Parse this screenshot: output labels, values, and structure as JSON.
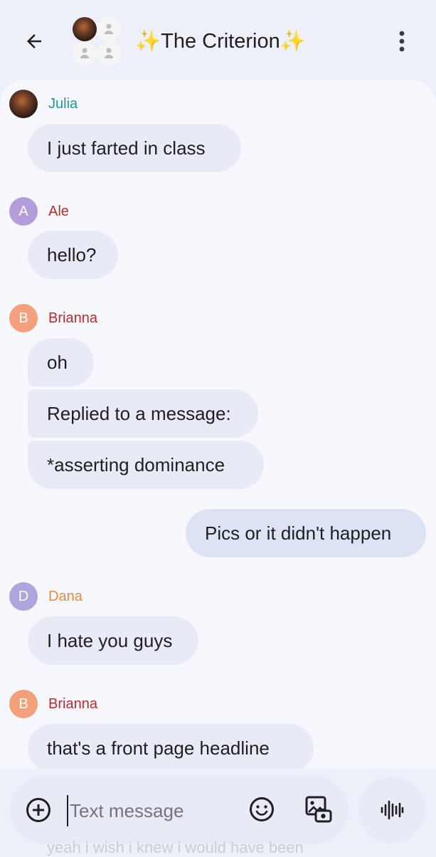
{
  "header": {
    "title": "✨The Criterion✨",
    "back_icon": "arrow-left-icon",
    "more_icon": "more-vert-icon"
  },
  "messages": [
    {
      "sender": "Julia",
      "sender_color": "#1a9aa0",
      "avatar": "photo",
      "texts": [
        "I just farted in class"
      ]
    },
    {
      "sender": "Ale",
      "sender_color": "#c62828",
      "avatar": "A",
      "avatar_color": "#b39ddb",
      "texts": [
        "hello?"
      ]
    },
    {
      "sender": "Brianna",
      "sender_color": "#c62828",
      "avatar": "B",
      "avatar_color": "#f4a07a",
      "texts": [
        "oh",
        "Replied to a message:",
        "*asserting dominance"
      ]
    },
    {
      "sender": "me",
      "texts": [
        "Pics or it didn't happen"
      ]
    },
    {
      "sender": "Dana",
      "sender_color": "#ef8a3c",
      "avatar": "D",
      "avatar_color": "#b0a4de",
      "texts": [
        "I hate you guys"
      ]
    },
    {
      "sender": "Brianna",
      "sender_color": "#c62828",
      "avatar": "B",
      "avatar_color": "#f4a07a",
      "texts": [
        "that's a front page headline"
      ]
    }
  ],
  "composer": {
    "placeholder": "Text message",
    "add_icon": "add-circle-icon",
    "emoji_icon": "emoji-icon",
    "gallery_icon": "gallery-icon",
    "voice_icon": "voice-waveform-icon"
  },
  "faded_preview": "yeah i wish i knew i would have been"
}
